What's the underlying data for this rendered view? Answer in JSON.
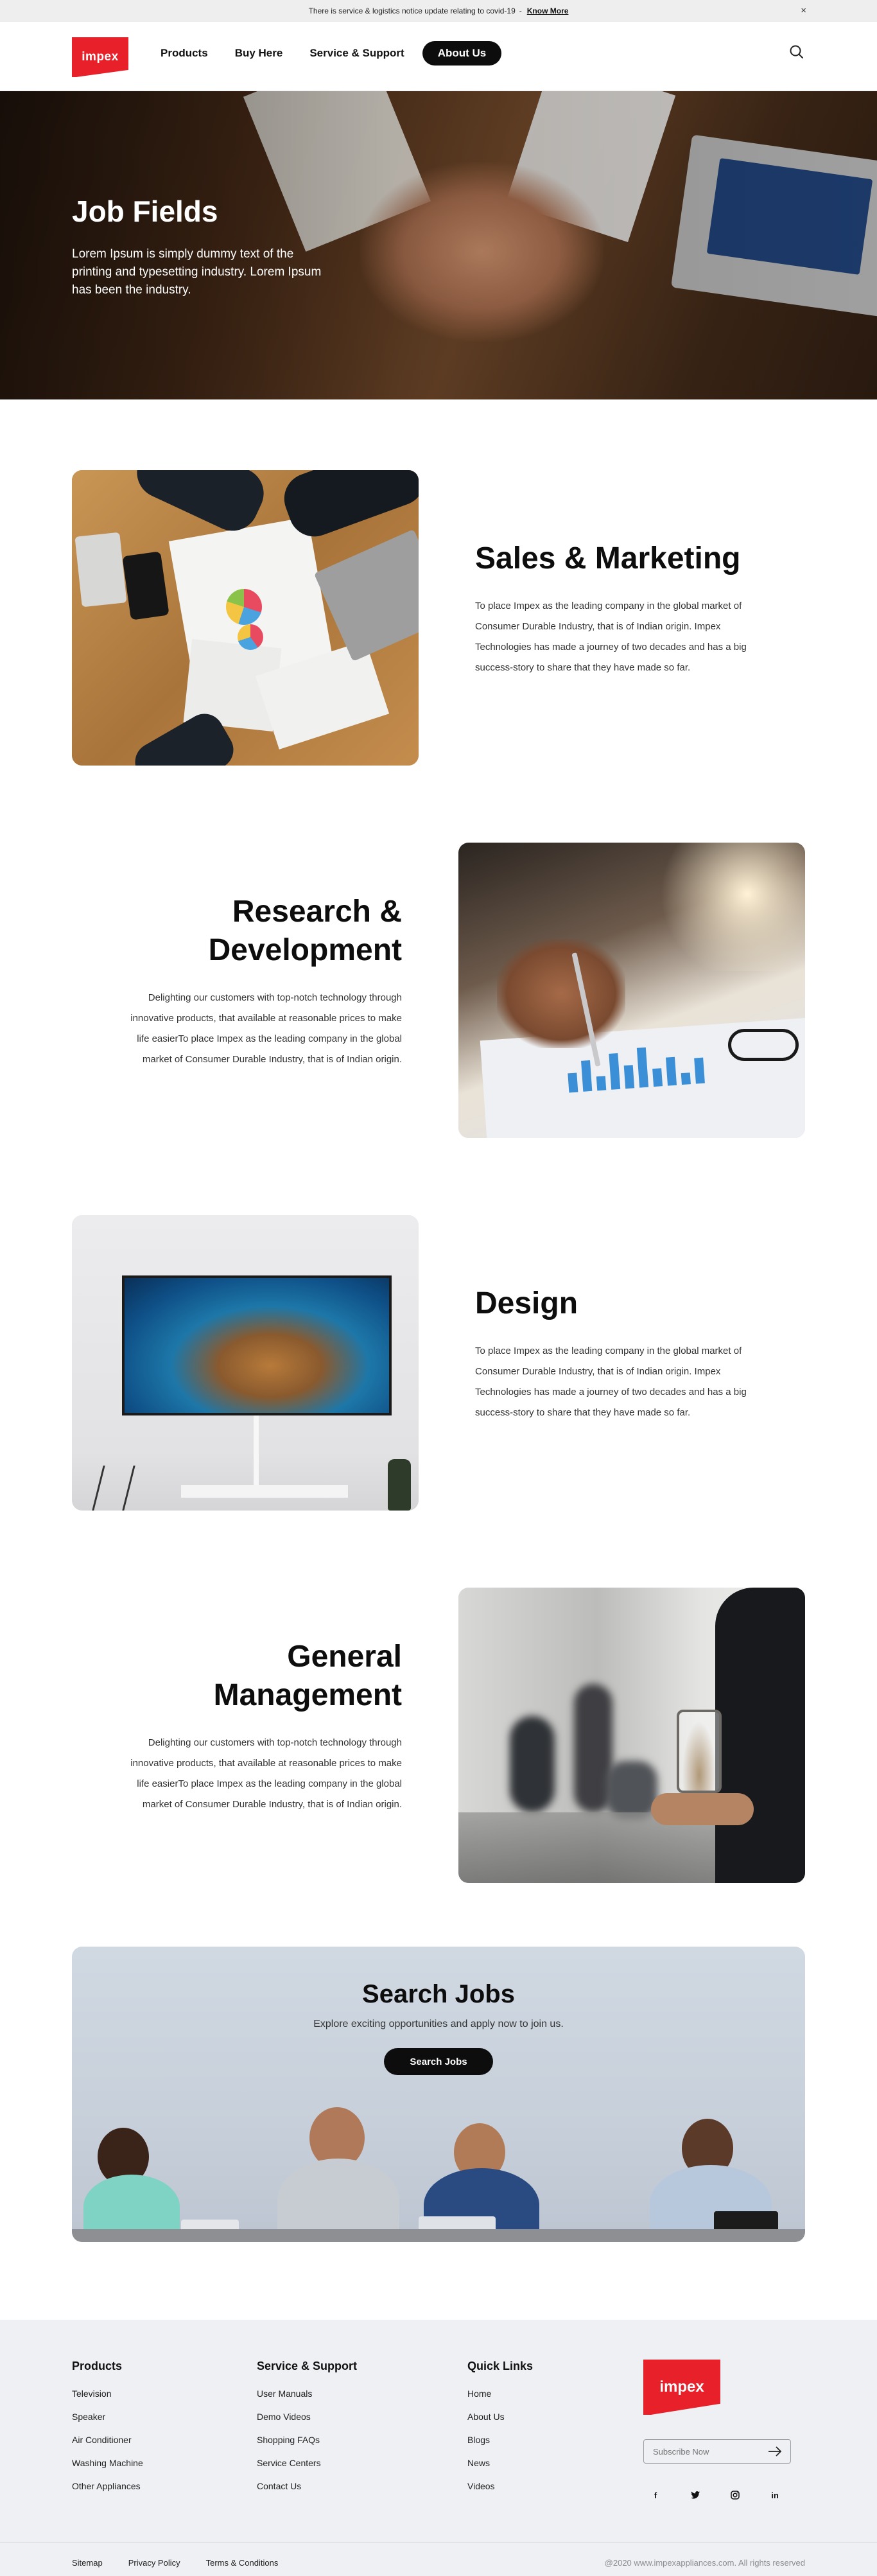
{
  "notice": {
    "text": "There is service & logistics notice update relating to covid-19",
    "separator": "-",
    "link": "Know More",
    "close": "×"
  },
  "header": {
    "logo": "impex",
    "nav": [
      "Products",
      "Buy Here",
      "Service & Support",
      "About Us"
    ],
    "active_nav": "About Us",
    "search_icon": "search-icon"
  },
  "hero": {
    "title": "Job Fields",
    "text": "Lorem Ipsum is simply dummy text of the printing and typesetting industry. Lorem Ipsum has been the industry."
  },
  "sections": [
    {
      "title": "Sales & Marketing",
      "text": "To place Impex as the leading company in the global market of Consumer Durable Industry, that is of Indian origin. Impex Technologies has made a journey of two decades and has a big success-story to share that they have made so far."
    },
    {
      "title": "Research & Development",
      "text": "Delighting our customers with top-notch technology through innovative products, that available at reasonable prices to make life easierTo place Impex as the leading company in the global market of Consumer Durable Industry, that is of Indian origin."
    },
    {
      "title": "Design",
      "text": "To place Impex as the leading company in the global market of Consumer Durable Industry, that is of Indian origin. Impex Technologies has made a journey of two decades and has a big success-story to share that they have made so far."
    },
    {
      "title": "General Management",
      "text": "Delighting our customers with top-notch technology through innovative products, that available at reasonable prices to make life easierTo place Impex as the leading company in the global market of Consumer Durable Industry, that is of Indian origin."
    }
  ],
  "search_jobs": {
    "title": "Search Jobs",
    "subtitle": "Explore exciting opportunities and apply now to join us.",
    "button": "Search Jobs"
  },
  "footer": {
    "products": {
      "heading": "Products",
      "links": [
        "Television",
        "Speaker",
        "Air Conditioner",
        "Washing Machine",
        "Other Appliances"
      ]
    },
    "service": {
      "heading": "Service & Support",
      "links": [
        "User Manuals",
        "Demo Videos",
        "Shopping FAQs",
        "Service Centers",
        "Contact Us"
      ]
    },
    "quick": {
      "heading": "Quick Links",
      "links": [
        "Home",
        "About Us",
        "Blogs",
        "News",
        "Videos"
      ]
    },
    "logo": "impex",
    "subscribe_placeholder": "Subscribe Now",
    "social": [
      "f",
      "t",
      "ig",
      "in"
    ],
    "bottom_links": [
      "Sitemap",
      "Privacy Policy",
      "Terms & Conditions"
    ],
    "copyright": "@2020 www.impexappliances.com. All rights reserved"
  },
  "colors": {
    "brand_red": "#e8202a",
    "dark": "#0d0d0d",
    "footer_bg": "#eef0f3"
  }
}
